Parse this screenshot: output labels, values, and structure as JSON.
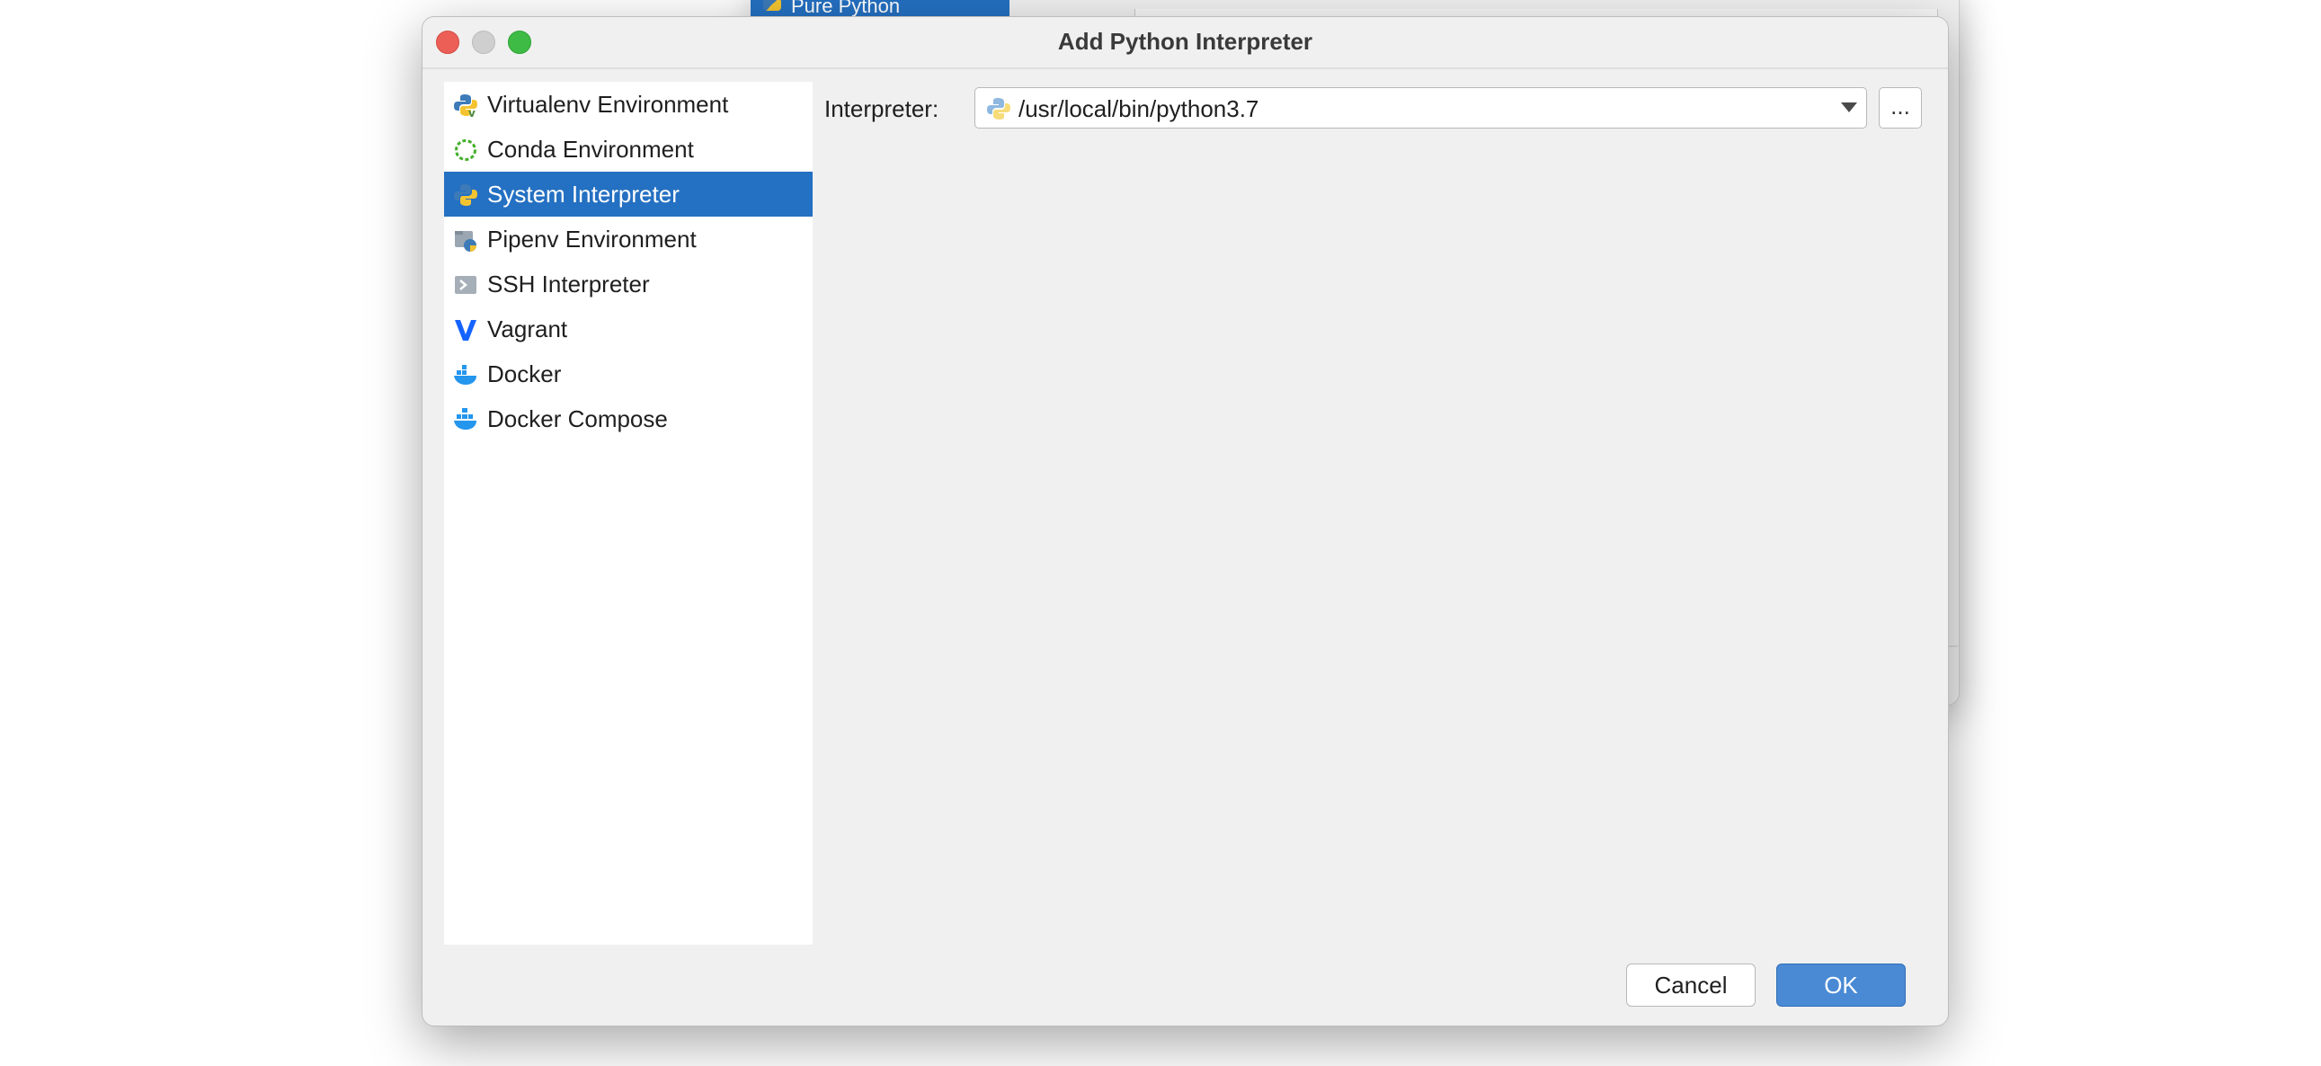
{
  "background_window": {
    "selected_item": "Pure Python"
  },
  "dialog": {
    "title": "Add Python Interpreter",
    "sidebar": {
      "items": [
        {
          "label": "Virtualenv Environment",
          "icon": "python-virtualenv-icon"
        },
        {
          "label": "Conda Environment",
          "icon": "conda-icon"
        },
        {
          "label": "System Interpreter",
          "icon": "python-icon",
          "selected": true
        },
        {
          "label": "Pipenv Environment",
          "icon": "pipenv-icon"
        },
        {
          "label": "SSH Interpreter",
          "icon": "ssh-terminal-icon"
        },
        {
          "label": "Vagrant",
          "icon": "vagrant-icon"
        },
        {
          "label": "Docker",
          "icon": "docker-icon"
        },
        {
          "label": "Docker Compose",
          "icon": "docker-compose-icon"
        }
      ]
    },
    "interpreter": {
      "label": "Interpreter:",
      "value": "/usr/local/bin/python3.7",
      "browse_label": "..."
    },
    "buttons": {
      "cancel": "Cancel",
      "ok": "OK"
    }
  },
  "colors": {
    "selection": "#2470c2",
    "ok_button": "#4a8ad4",
    "close": "#ec5f57",
    "maximize": "#3ebb45"
  }
}
